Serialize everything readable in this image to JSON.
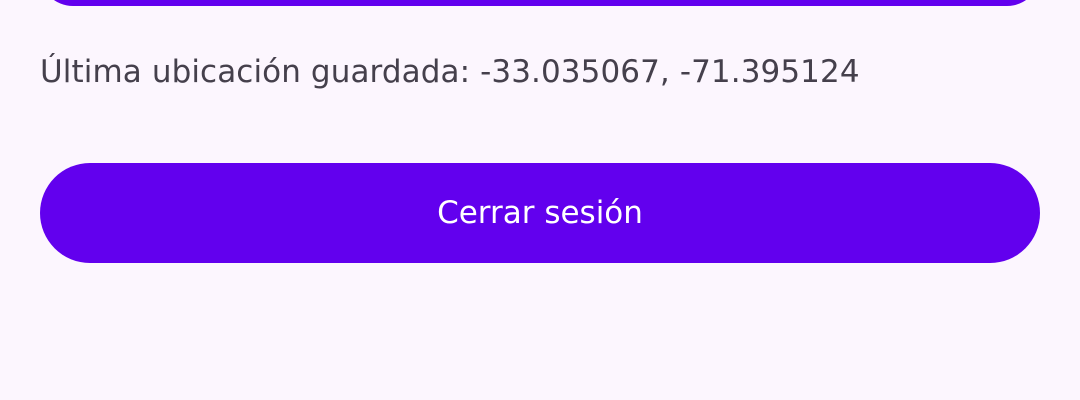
{
  "location": {
    "text": "Última ubicación guardada: -33.035067, -71.395124"
  },
  "logout_button": {
    "label": "Cerrar sesión"
  },
  "colors": {
    "background": "#FCF6FE",
    "primary": "#6200EE",
    "text": "#45404C",
    "on_primary": "#FFFFFF"
  }
}
